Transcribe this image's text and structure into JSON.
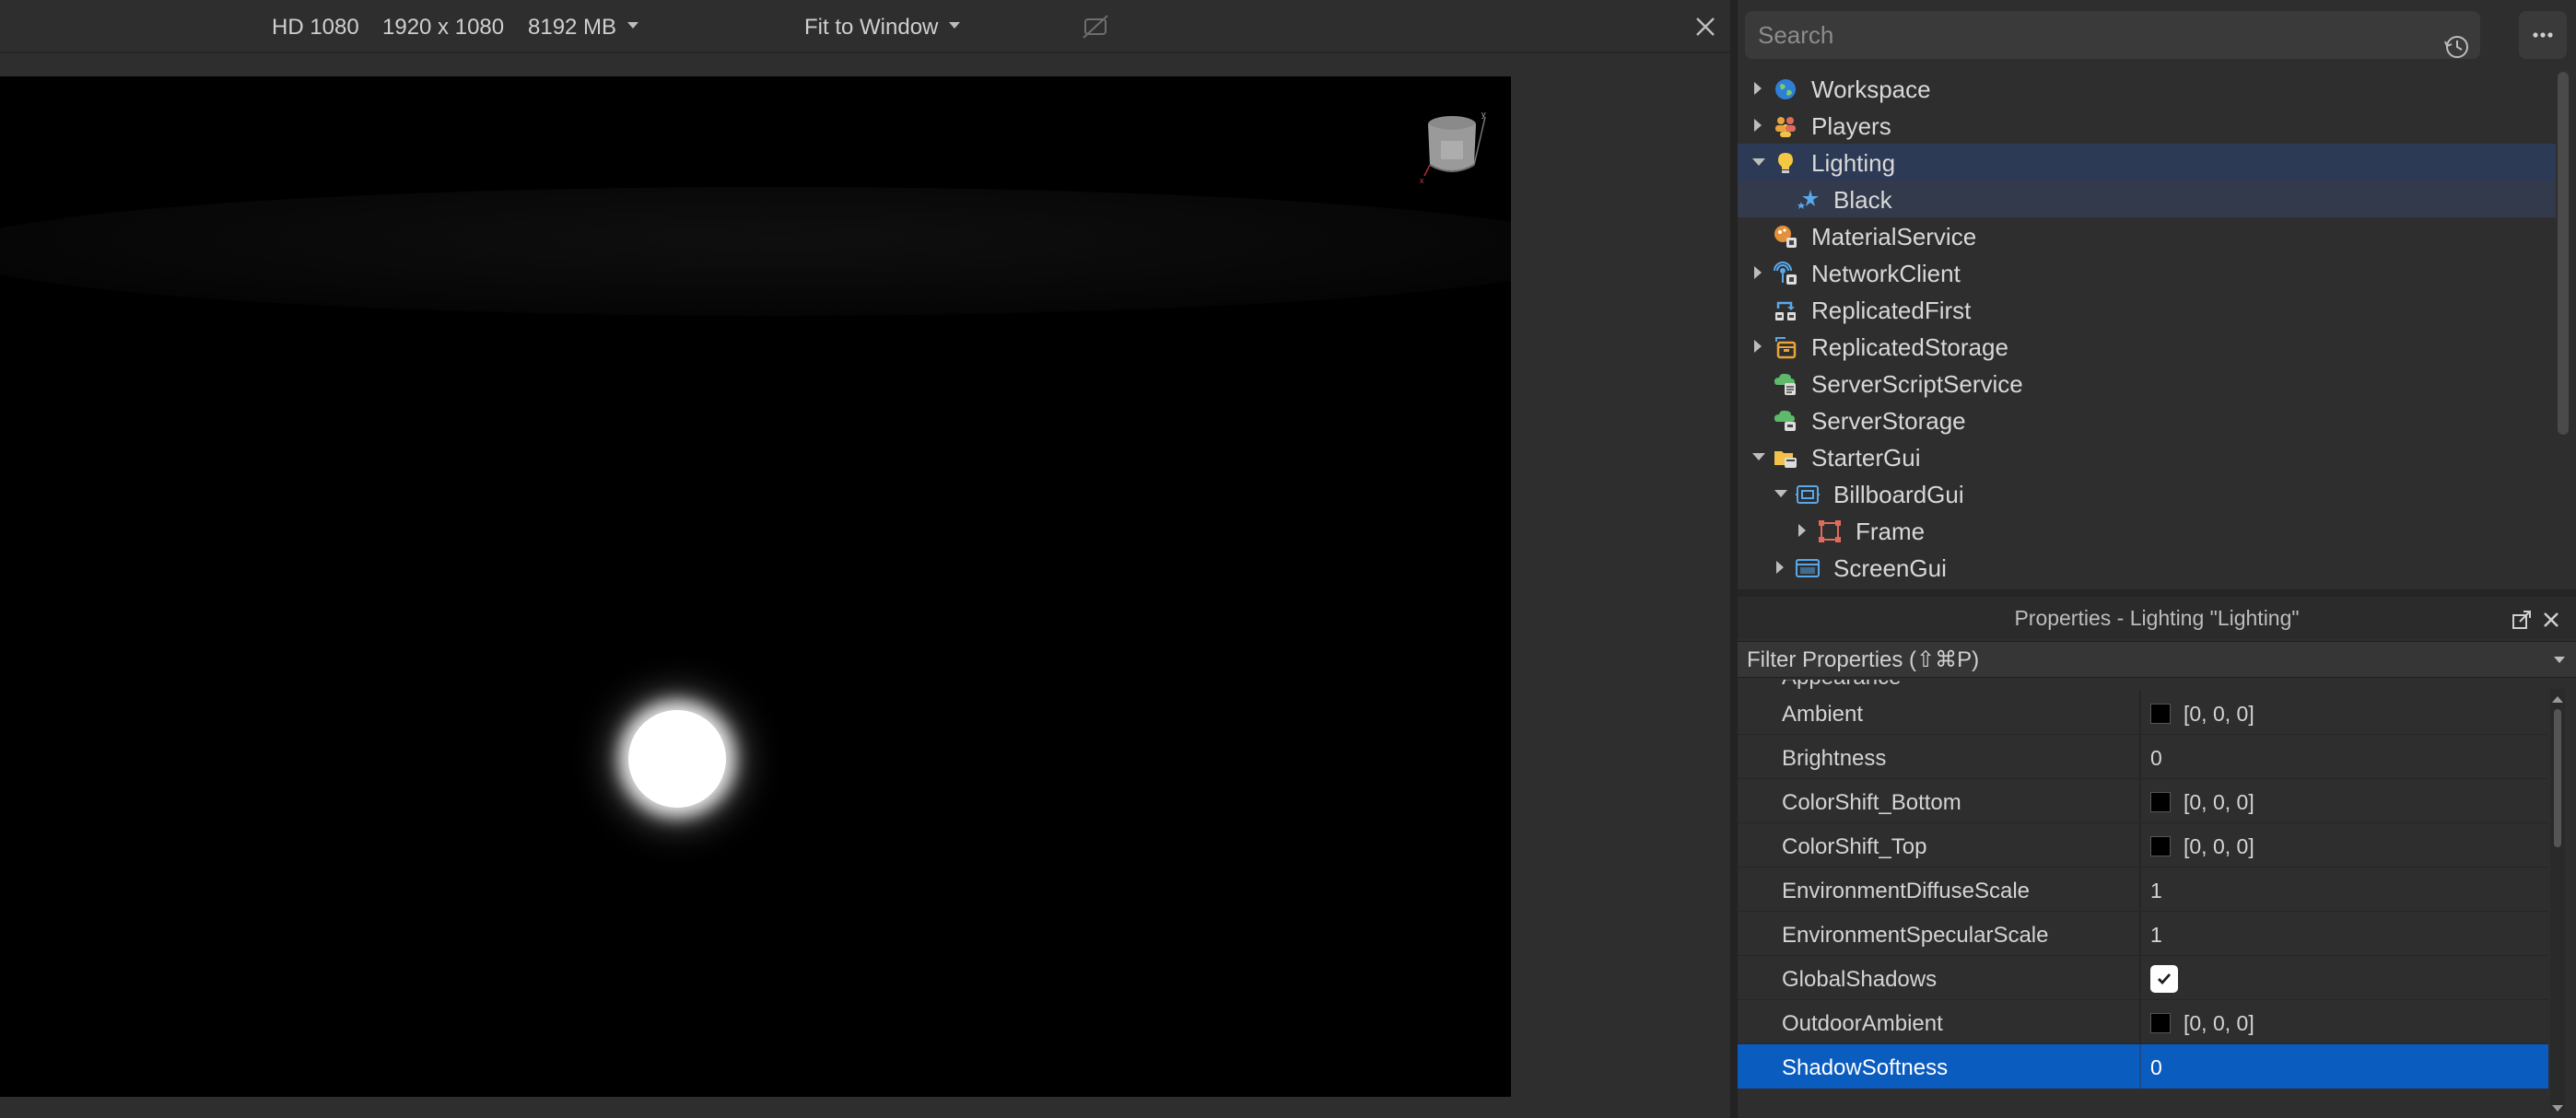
{
  "emulator": {
    "device": "HD 1080",
    "resolution": "1920 x 1080",
    "memory": "8192 MB",
    "fit_mode": "Fit to Window"
  },
  "explorer": {
    "search_placeholder": "Search",
    "items": [
      {
        "label": "Workspace",
        "icon": "globe-icon",
        "expand": "collapsed",
        "depth": 0
      },
      {
        "label": "Players",
        "icon": "players-icon",
        "expand": "collapsed",
        "depth": 0
      },
      {
        "label": "Lighting",
        "icon": "lightbulb-icon",
        "expand": "expanded",
        "depth": 0,
        "selected": true
      },
      {
        "label": "Black",
        "icon": "sky-icon",
        "expand": "none",
        "depth": 1
      },
      {
        "label": "MaterialService",
        "icon": "material-service-icon",
        "expand": "none",
        "depth": 0
      },
      {
        "label": "NetworkClient",
        "icon": "network-client-icon",
        "expand": "collapsed",
        "depth": 0
      },
      {
        "label": "ReplicatedFirst",
        "icon": "replicated-first-icon",
        "expand": "none",
        "depth": 0
      },
      {
        "label": "ReplicatedStorage",
        "icon": "replicated-storage-icon",
        "expand": "collapsed",
        "depth": 0
      },
      {
        "label": "ServerScriptService",
        "icon": "server-script-service-icon",
        "expand": "none",
        "depth": 0
      },
      {
        "label": "ServerStorage",
        "icon": "server-storage-icon",
        "expand": "none",
        "depth": 0
      },
      {
        "label": "StarterGui",
        "icon": "folder-icon",
        "expand": "expanded",
        "depth": 0
      },
      {
        "label": "BillboardGui",
        "icon": "billboard-gui-icon",
        "expand": "expanded",
        "depth": 1
      },
      {
        "label": "Frame",
        "icon": "frame-icon",
        "expand": "collapsed",
        "depth": 2
      },
      {
        "label": "ScreenGui",
        "icon": "screen-gui-icon",
        "expand": "collapsed",
        "depth": 1
      }
    ]
  },
  "properties": {
    "title": "Properties - Lighting \"Lighting\"",
    "filter_placeholder": "Filter Properties (⇧⌘P)",
    "category": "Appearance",
    "rows": [
      {
        "name": "Ambient",
        "value": "[0, 0, 0]",
        "swatch": "#000000"
      },
      {
        "name": "Brightness",
        "value": "0"
      },
      {
        "name": "ColorShift_Bottom",
        "value": "[0, 0, 0]",
        "swatch": "#000000"
      },
      {
        "name": "ColorShift_Top",
        "value": "[0, 0, 0]",
        "swatch": "#000000"
      },
      {
        "name": "EnvironmentDiffuseScale",
        "value": "1"
      },
      {
        "name": "EnvironmentSpecularScale",
        "value": "1"
      },
      {
        "name": "GlobalShadows",
        "checked": true
      },
      {
        "name": "OutdoorAmbient",
        "value": "[0, 0, 0]",
        "swatch": "#000000"
      },
      {
        "name": "ShadowSoftness",
        "value": "0",
        "selected": true
      }
    ]
  },
  "colors": {
    "selection_blue": "#0b5cbf",
    "tree_selection": "#2d3a55",
    "panel_bg": "#2e2e2e"
  }
}
